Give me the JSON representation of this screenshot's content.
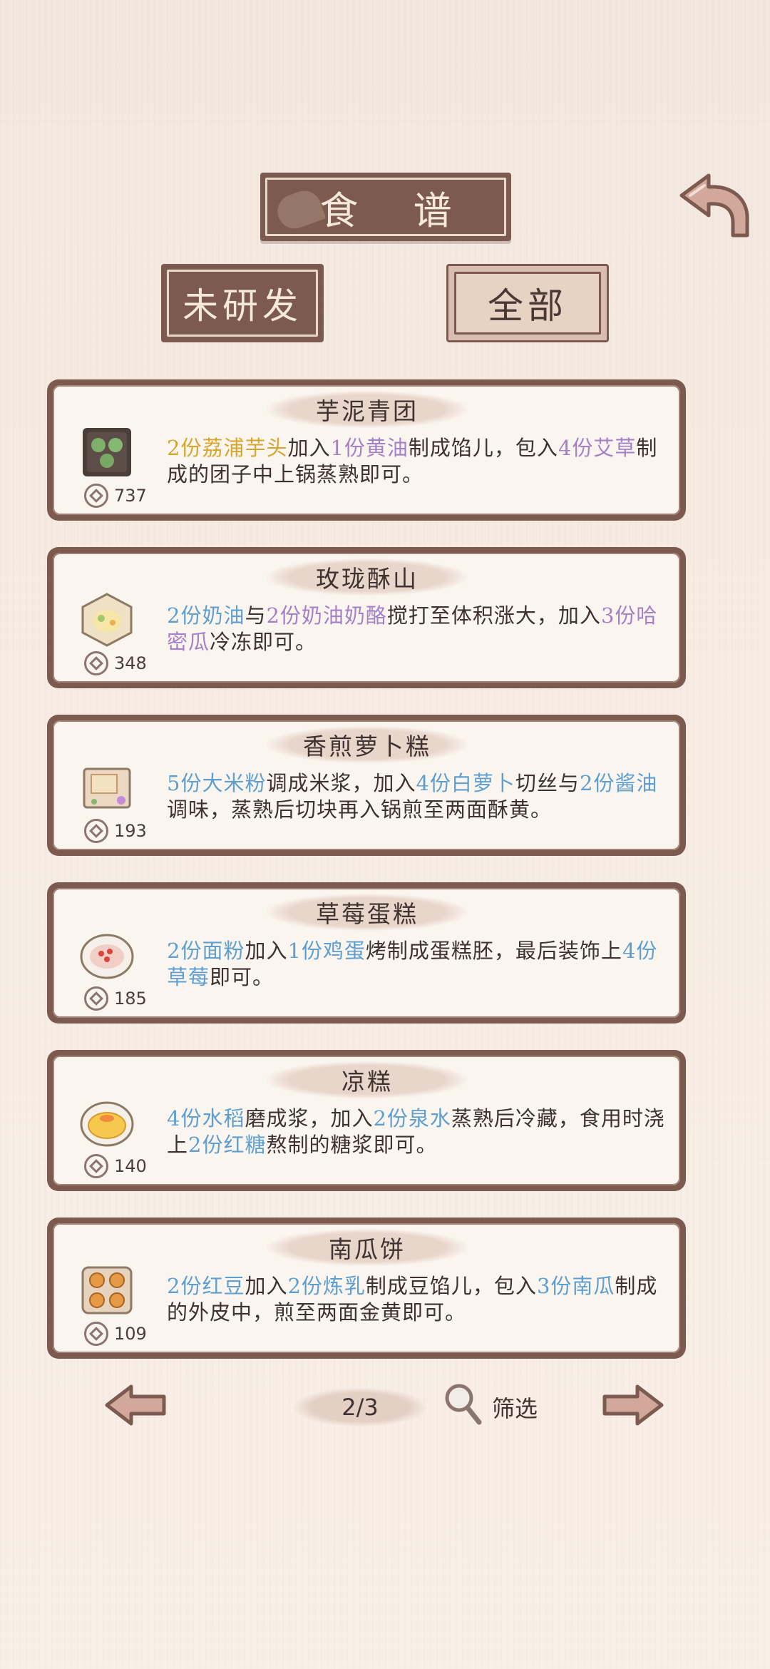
{
  "header": {
    "title": "食 谱",
    "back_icon": "curved-back-arrow"
  },
  "tabs": [
    {
      "label": "未研发",
      "selected": false
    },
    {
      "label": "全部",
      "selected": true
    }
  ],
  "colors": {
    "frame_brown": "#7d5a4f",
    "ingredient_yellow": "#d6a52c",
    "ingredient_purple": "#a480c8",
    "ingredient_blue": "#5f9fd0"
  },
  "recipes": [
    {
      "name": "芋泥青团",
      "cost": "737",
      "icon": "green-dumplings-dish",
      "desc": [
        {
          "t": "2份荔浦芋头",
          "c": "y"
        },
        {
          "t": "加入",
          "c": ""
        },
        {
          "t": "1份黄油",
          "c": "p"
        },
        {
          "t": "制成馅儿，包入",
          "c": ""
        },
        {
          "t": "4份艾草",
          "c": "p"
        },
        {
          "t": "制成的团子中上锅蒸熟即可。",
          "c": ""
        }
      ]
    },
    {
      "name": "玫珑酥山",
      "cost": "348",
      "icon": "frozen-cream-dish",
      "desc": [
        {
          "t": "2份奶油",
          "c": "b"
        },
        {
          "t": "与",
          "c": ""
        },
        {
          "t": "2份奶油奶酪",
          "c": "p"
        },
        {
          "t": "搅打至体积涨大，加入",
          "c": ""
        },
        {
          "t": "3份哈密瓜",
          "c": "p"
        },
        {
          "t": "冷冻即可。",
          "c": ""
        }
      ]
    },
    {
      "name": "香煎萝卜糕",
      "cost": "193",
      "icon": "radish-cake-dish",
      "desc": [
        {
          "t": "5份大米粉",
          "c": "b"
        },
        {
          "t": "调成米浆，加入",
          "c": ""
        },
        {
          "t": "4份白萝卜",
          "c": "b"
        },
        {
          "t": "切丝与",
          "c": ""
        },
        {
          "t": "2份酱油",
          "c": "b"
        },
        {
          "t": "调味，蒸熟后切块再入锅煎至两面酥黄。",
          "c": ""
        }
      ]
    },
    {
      "name": "草莓蛋糕",
      "cost": "185",
      "icon": "strawberry-cake-dish",
      "desc": [
        {
          "t": "2份面粉",
          "c": "b"
        },
        {
          "t": "加入",
          "c": ""
        },
        {
          "t": "1份鸡蛋",
          "c": "b"
        },
        {
          "t": "烤制成蛋糕胚，最后装饰上",
          "c": ""
        },
        {
          "t": "4份草莓",
          "c": "b"
        },
        {
          "t": "即可。",
          "c": ""
        }
      ]
    },
    {
      "name": "凉糕",
      "cost": "140",
      "icon": "cold-rice-cake-dish",
      "desc": [
        {
          "t": "4份水稻",
          "c": "b"
        },
        {
          "t": "磨成浆，加入",
          "c": ""
        },
        {
          "t": "2份泉水",
          "c": "b"
        },
        {
          "t": "蒸熟后冷藏，食用时浇上",
          "c": ""
        },
        {
          "t": "2份红糖",
          "c": "b"
        },
        {
          "t": "熬制的糖浆即可。",
          "c": ""
        }
      ]
    },
    {
      "name": "南瓜饼",
      "cost": "109",
      "icon": "pumpkin-cake-dish",
      "desc": [
        {
          "t": "2份红豆",
          "c": "b"
        },
        {
          "t": "加入",
          "c": ""
        },
        {
          "t": "2份炼乳",
          "c": "b"
        },
        {
          "t": "制成豆馅儿，包入",
          "c": ""
        },
        {
          "t": "3份南瓜",
          "c": "b"
        },
        {
          "t": "制成的外皮中，煎至两面金黄即可。",
          "c": ""
        }
      ]
    }
  ],
  "pager": {
    "page": "2/3",
    "filter_label": "筛选"
  }
}
